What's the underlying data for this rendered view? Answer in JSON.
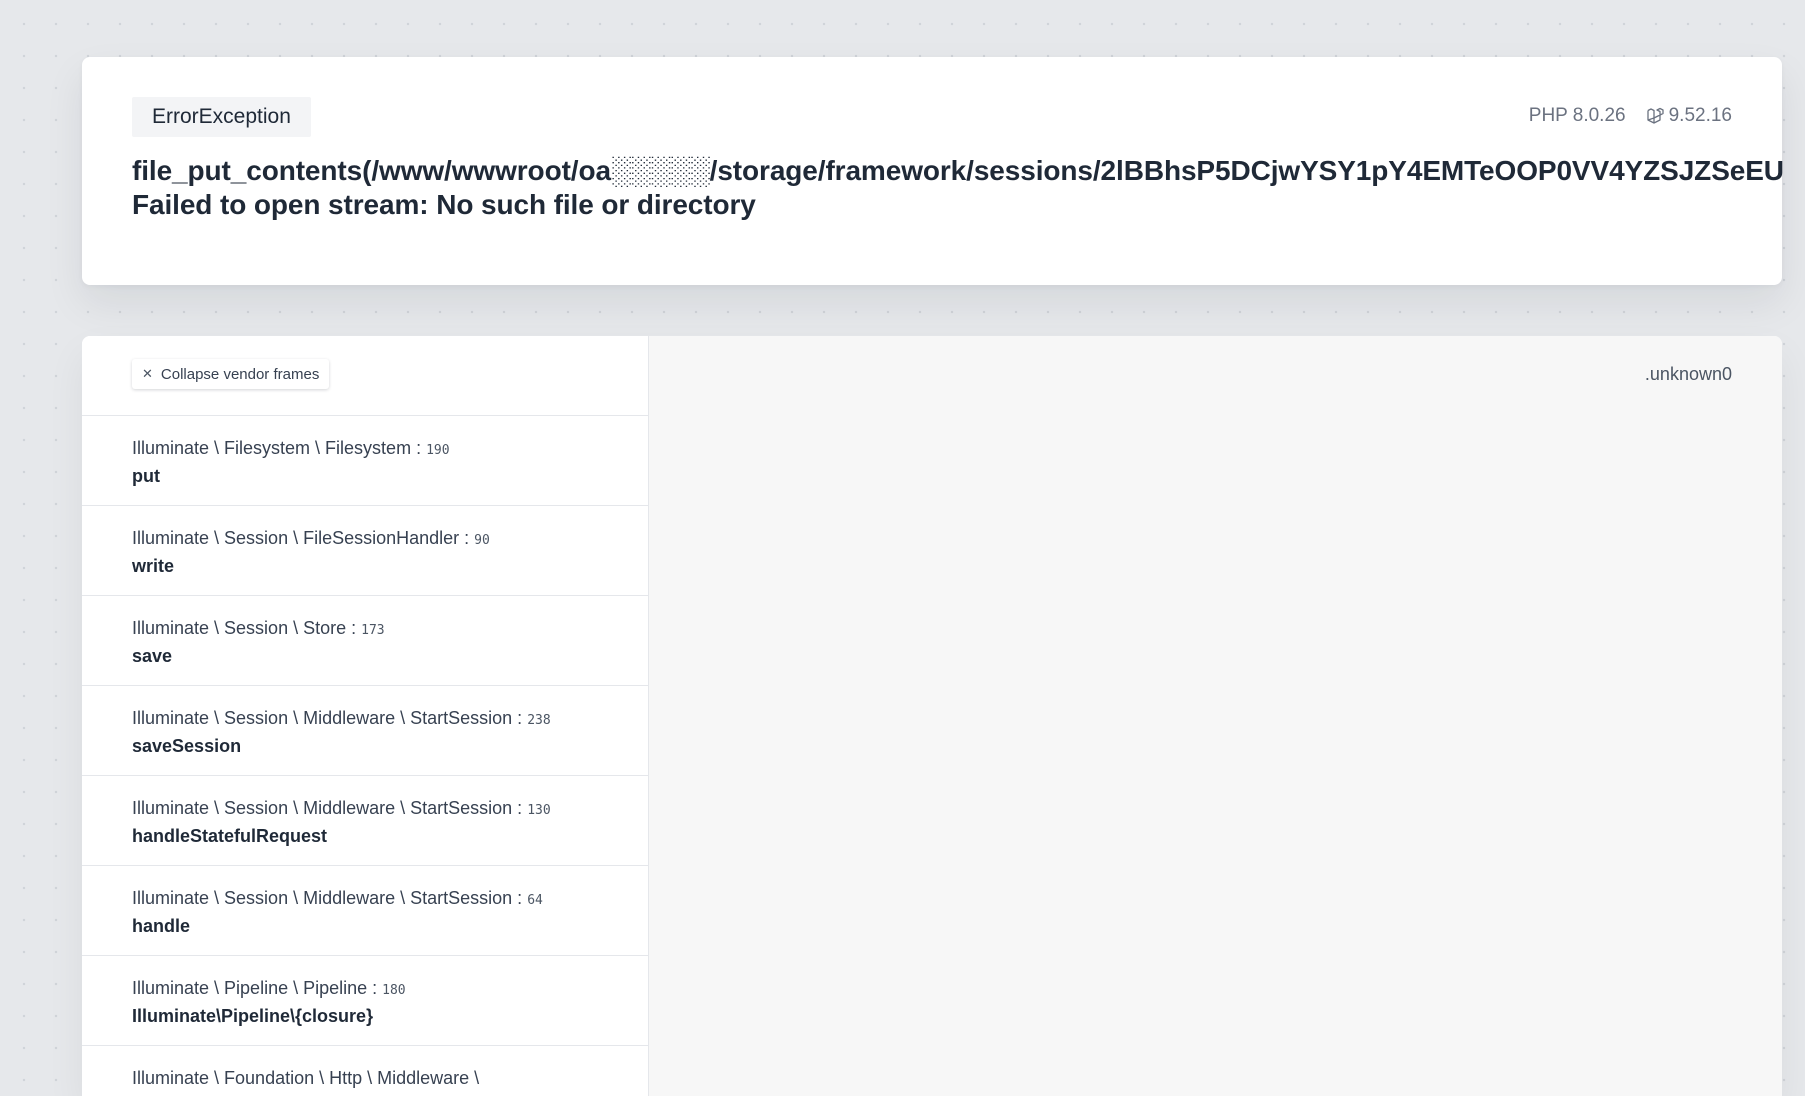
{
  "header": {
    "exception_class": "ErrorException",
    "php_version": "PHP 8.0.26",
    "laravel_version": "9.52.16",
    "message_line1": "file_put_contents(/www/wwwroot/oa░░░░░/storage/framework/sessions/2lBBhsP5DCjwYSY1pY4EMTeOOP0VV4YZSJZSeEU",
    "message_line2": "Failed to open stream: No such file or directory"
  },
  "frames_panel": {
    "collapse_label": "Collapse vendor frames",
    "collapse_icon": "close-icon",
    "frames": [
      {
        "class": "Illuminate \\ Filesystem \\ Filesystem",
        "line": "190",
        "method": "put"
      },
      {
        "class": "Illuminate \\ Session \\ FileSessionHandler",
        "line": "90",
        "method": "write"
      },
      {
        "class": "Illuminate \\ Session \\ Store",
        "line": "173",
        "method": "save"
      },
      {
        "class": "Illuminate \\ Session \\ Middleware \\ StartSession",
        "line": "238",
        "method": "saveSession"
      },
      {
        "class": "Illuminate \\ Session \\ Middleware \\ StartSession",
        "line": "130",
        "method": "handleStatefulRequest"
      },
      {
        "class": "Illuminate \\ Session \\ Middleware \\ StartSession",
        "line": "64",
        "method": "handle"
      },
      {
        "class": "Illuminate \\ Pipeline \\ Pipeline",
        "line": "180",
        "method": "Illuminate\\Pipeline\\{closure}"
      },
      {
        "class": "Illuminate \\ Foundation \\ Http \\ Middleware \\",
        "line": "",
        "method": ""
      }
    ]
  },
  "code_panel": {
    "file_name": ".unknown0"
  }
}
